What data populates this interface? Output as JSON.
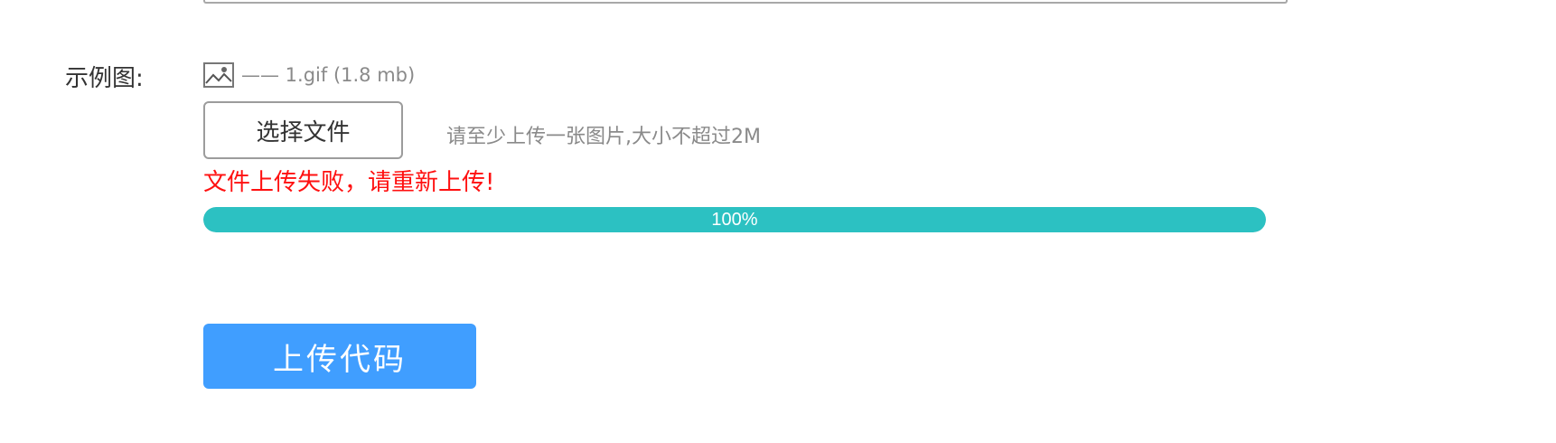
{
  "form": {
    "example_label": "示例图:",
    "file": {
      "icon": "broken-image-icon",
      "meta_text": "—— 1.gif (1.8 mb)"
    },
    "choose_button": "选择文件",
    "hint": "请至少上传一张图片,大小不超过2M",
    "error_message": "文件上传失败，请重新上传!",
    "progress": {
      "percent": 100,
      "label": "100%"
    },
    "submit_button": "上传代码"
  },
  "colors": {
    "error": "#ff1010",
    "progress": "#2cc1c2",
    "primary_button": "#409eff",
    "muted_text": "#8a8a8a"
  }
}
